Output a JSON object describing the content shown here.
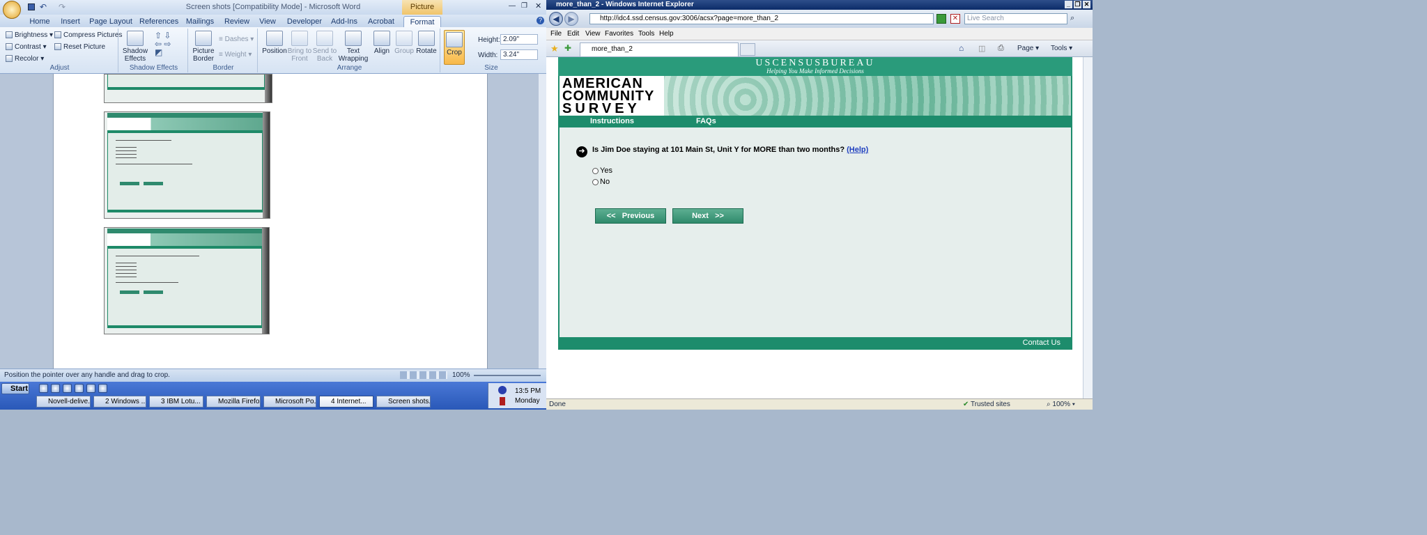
{
  "word": {
    "title": "Screen shots [Compatibility Mode] - Microsoft Word",
    "picture_tools": "Picture Tools",
    "tabs": [
      "Home",
      "Insert",
      "Page Layout",
      "References",
      "Mailings",
      "Review",
      "View",
      "Developer",
      "Add-Ins",
      "Acrobat",
      "Format"
    ],
    "adjust": {
      "brightness": "Brightness",
      "compress": "Compress Pictures",
      "contrast": "Contrast",
      "reset": "Reset Picture",
      "recolor": "Recolor",
      "label": "Adjust"
    },
    "shadow": {
      "btn": "Shadow Effects",
      "label": "Shadow Effects"
    },
    "border": {
      "picture_border": "Picture Border",
      "dashes": "Dashes",
      "weight": "Weight",
      "label": "Border"
    },
    "arrange": {
      "position": "Position",
      "bring": "Bring to Front",
      "send": "Send to Back",
      "text_wrap": "Text Wrapping",
      "align": "Align",
      "group": "Group",
      "rotate": "Rotate",
      "label": "Arrange"
    },
    "size": {
      "crop": "Crop",
      "height_label": "Height:",
      "height": "2.09\"",
      "width_label": "Width:",
      "width": "3.24\"",
      "label": "Size"
    },
    "status": "Position the pointer over any handle and drag to crop.",
    "zoom": "100%"
  },
  "taskbar": {
    "start": "Start",
    "buttons": [
      "Novell-delive...",
      "2 Windows ...",
      "3 IBM Lotu...",
      "Mozilla Firefox",
      "Microsoft Po...",
      "4 Internet...",
      "Screen shots..."
    ],
    "time": "13:5 PM",
    "day": "Monday"
  },
  "ie": {
    "title": "more_than_2 - Windows Internet Explorer",
    "url": "http://idc4.ssd.census.gov:3006/acsx?page=more_than_2",
    "search_placeholder": "Live Search",
    "menu": [
      "File",
      "Edit",
      "View",
      "Favorites",
      "Tools",
      "Help"
    ],
    "tab": "more_than_2",
    "cmd": {
      "page": "Page",
      "tools": "Tools"
    },
    "status": "Done",
    "zone": "Trusted sites",
    "zoom": "100%"
  },
  "census": {
    "agency": "USCENSUSBUREAU",
    "tagline": "Helping You Make Informed Decisions",
    "logo": [
      "AMERICAN",
      "COMMUNITY",
      "SURVEY"
    ],
    "nav": [
      "Instructions",
      "FAQs"
    ],
    "question": "Is Jim Doe staying at 101 Main St, Unit Y for MORE than two months?",
    "help": "(Help)",
    "options": [
      "Yes",
      "No"
    ],
    "prev": "<<   Previous",
    "next": "Next   >>",
    "contact": "Contact Us"
  }
}
